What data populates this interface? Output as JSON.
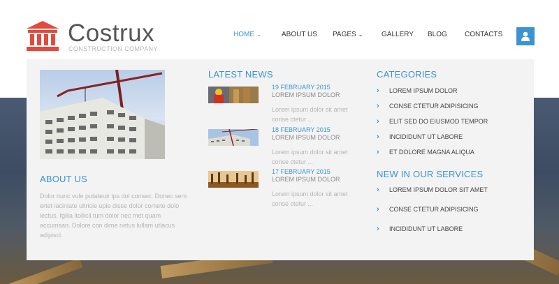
{
  "brand": {
    "title": "Costrux",
    "subtitle": "CONSTRUCTION COMPANY",
    "accent": "#3b93d4",
    "logo_color": "#e24a3b"
  },
  "nav": {
    "items": [
      {
        "label": "HOME",
        "active": true,
        "has_caret": true
      },
      {
        "label": "ABOUT US",
        "active": false,
        "has_caret": false
      },
      {
        "label": "PAGES",
        "active": false,
        "has_caret": true
      },
      {
        "label": "GALLERY",
        "active": false,
        "has_caret": false
      },
      {
        "label": "BLOG",
        "active": false,
        "has_caret": false
      },
      {
        "label": "CONTACTS",
        "active": false,
        "has_caret": false
      }
    ],
    "caret": "⌄",
    "user_icon": "user-icon"
  },
  "dropdown": {
    "about": {
      "title": "ABOUT US",
      "text": "Dolor nunc vule putateuir ips dol consec. Donec sem ertet laciniate ultricie upie disse dolor comete dolo lectus. fgilla itollicil tum dolor nec met quam accumsan. Dolore con dime netus lullam utlacus adipisci."
    },
    "news": {
      "title": "LATEST NEWS",
      "items": [
        {
          "date": "19 FEBRUARY 2015",
          "title": "LOREM IPSUM DOLOR",
          "excerpt": "Lorem ipsum dolor sit amet conse ctetur ..."
        },
        {
          "date": "18 FEBRUARY 2015",
          "title": "LOREM IPSUM DOLOR",
          "excerpt": "Lorem ipsum dolor sit amet conse ctetur ..."
        },
        {
          "date": "17 FEBRUARY 2015",
          "title": "LOREM IPSUM DOLOR",
          "excerpt": "Lorem ipsum dolor sit amet conse ctetur ..."
        }
      ]
    },
    "categories": {
      "title": "CATEGORIES",
      "items": [
        "LOREM IPSUM DOLOR",
        "CONSE CTETUR ADIPISICING",
        "ELIT SED DO EIUSMOD TEMPOR",
        "INCIDIDUNT UT LABORE",
        "ET DOLORE MAGNA ALIQUA"
      ]
    },
    "services": {
      "title": "NEW IN OUR SERVICES",
      "items": [
        "LOREM IPSUM DOLOR SIT AMET",
        "CONSE CTETUR ADIPISICING",
        "INCIDIDUNT UT LABORE"
      ]
    }
  }
}
